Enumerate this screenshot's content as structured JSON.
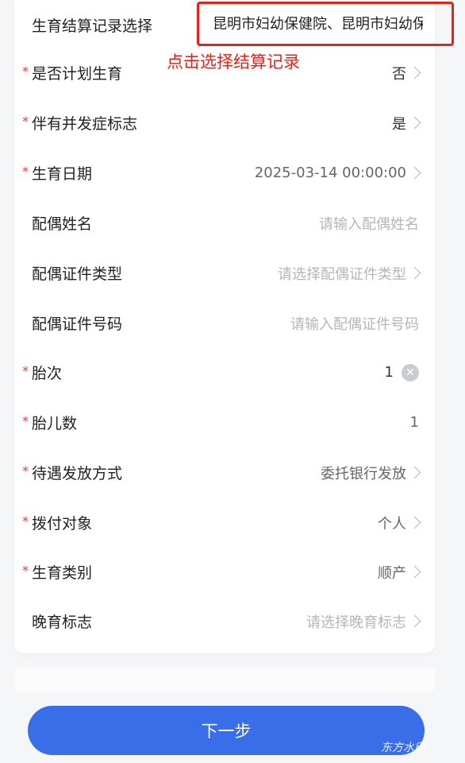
{
  "settlement": {
    "label": "生育结算记录选择",
    "value": "昆明市妇幼保健院、昆明市妇幼保健院",
    "annotation": "点击选择结算记录"
  },
  "fields": [
    {
      "label": "是否计划生育",
      "value": "否",
      "required": true
    },
    {
      "label": "伴有并发症标志",
      "value": "是",
      "required": true
    },
    {
      "label": "生育日期",
      "value": "2025-03-14 00:00:00",
      "required": true
    },
    {
      "label": "配偶姓名",
      "placeholder": "请输入配偶姓名",
      "required": false
    },
    {
      "label": "配偶证件类型",
      "placeholder": "请选择配偶证件类型",
      "required": false
    },
    {
      "label": "配偶证件号码",
      "placeholder": "请输入配偶证件号码",
      "required": false
    },
    {
      "label": "胎次",
      "value": "1",
      "required": true
    },
    {
      "label": "胎儿数",
      "value": "1",
      "required": true
    },
    {
      "label": "待遇发放方式",
      "value": "委托银行发放",
      "required": true
    },
    {
      "label": "拨付对象",
      "value": "个人",
      "required": true
    },
    {
      "label": "生育类别",
      "value": "顺产",
      "required": true
    },
    {
      "label": "晚育标志",
      "placeholder": "请选择晚育标志",
      "required": false
    }
  ],
  "required_mark": "*",
  "clear_glyph": "✕",
  "next_button": "下一步",
  "watermark": "东方水印",
  "colors": {
    "accent": "#3a6ee8",
    "highlight": "#e8221b",
    "required": "#e53935"
  }
}
